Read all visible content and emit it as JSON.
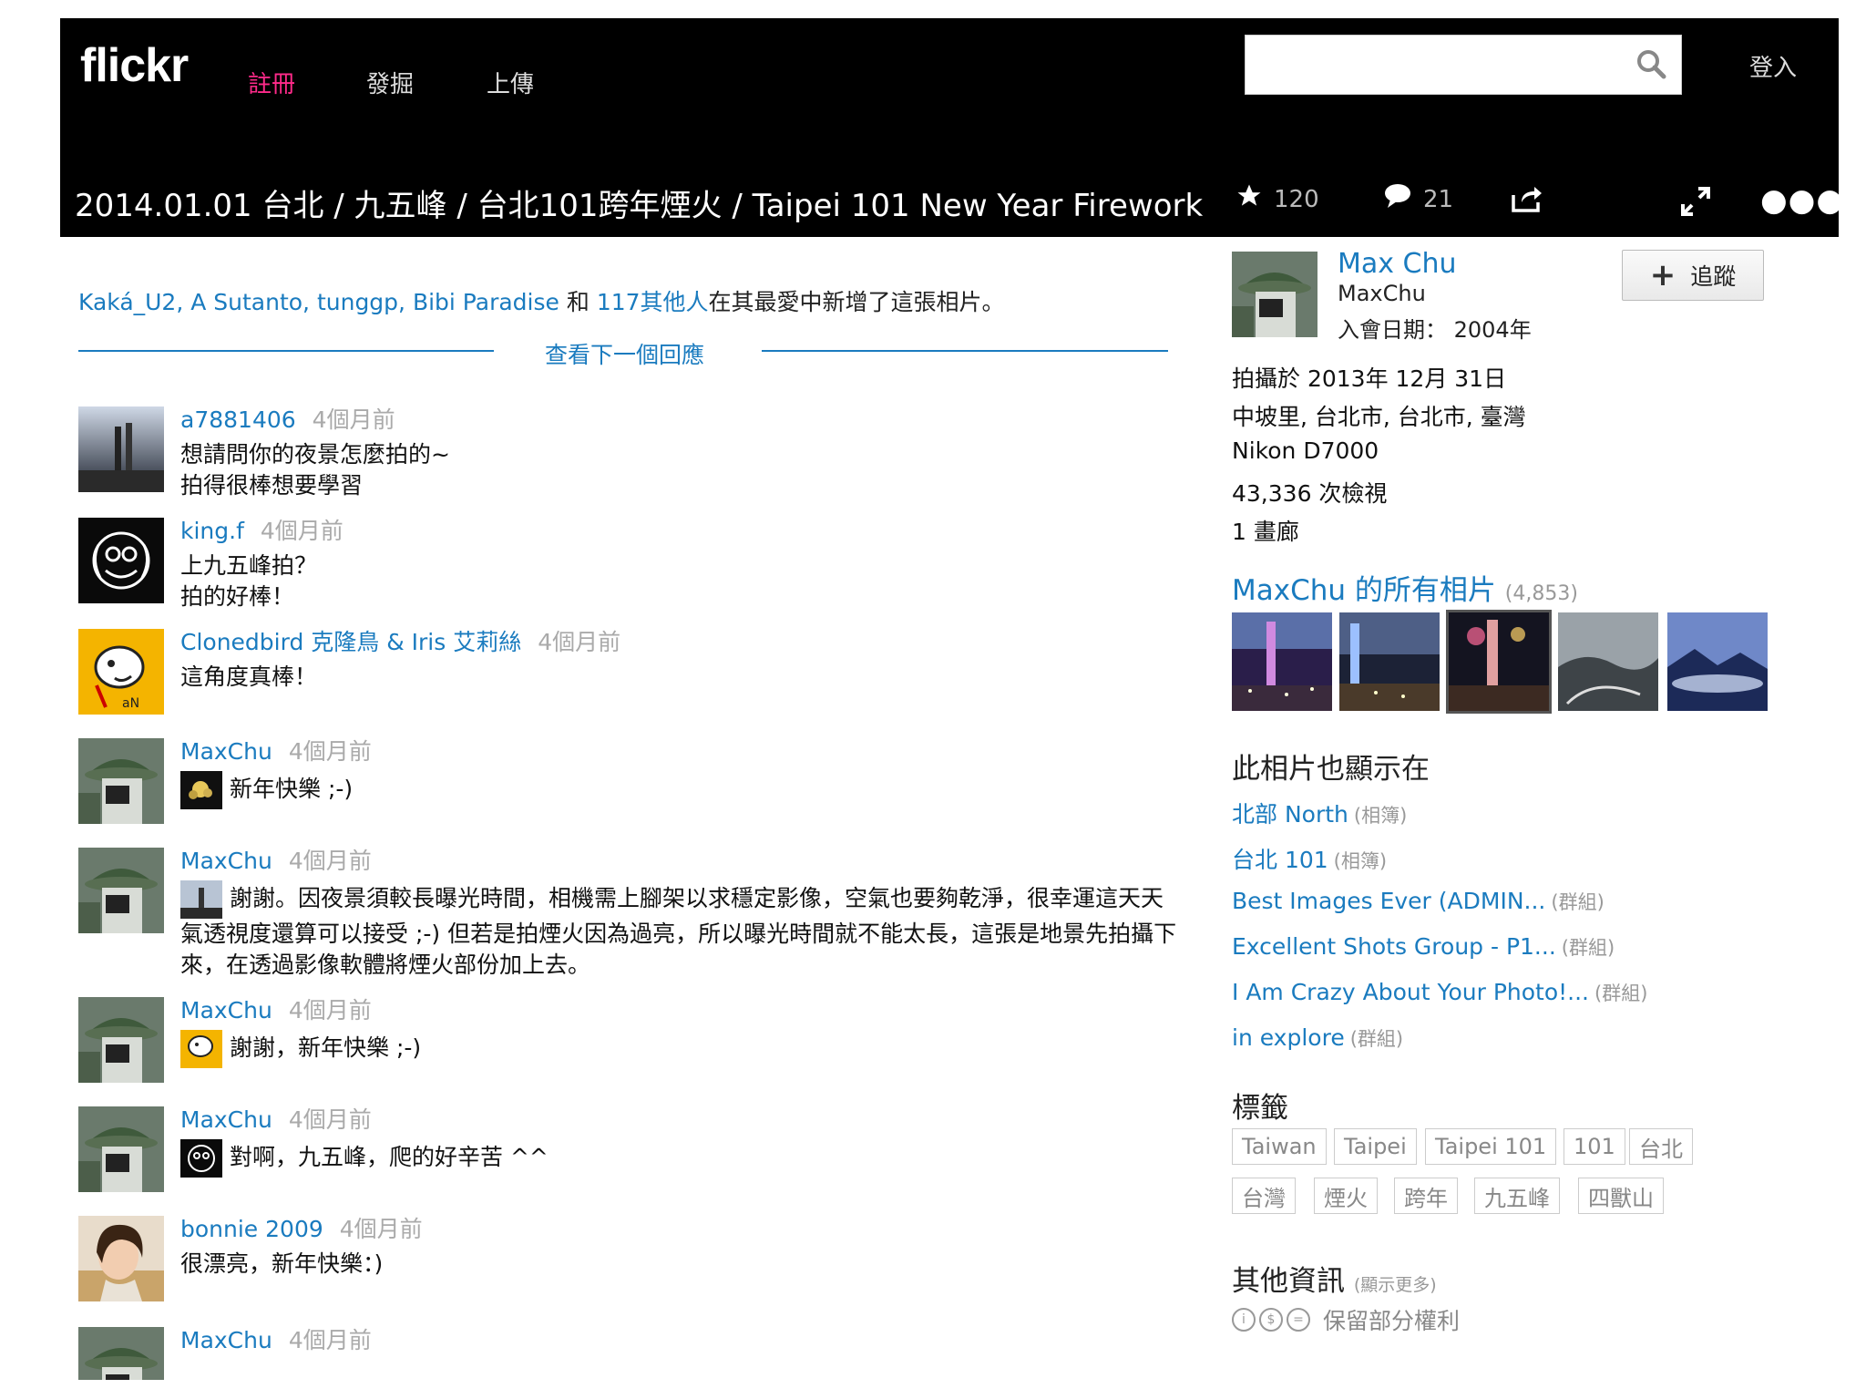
{
  "header": {
    "logo": "flickr",
    "nav": {
      "register": "註冊",
      "explore": "發掘",
      "upload": "上傳"
    },
    "search": {
      "value": "",
      "placeholder": ""
    },
    "login": "登入"
  },
  "photo": {
    "title": "2014.01.01 台北 / 九五峰 / 台北101跨年煙火 / Taipei 101 New Year Firework",
    "faves_count": "120",
    "comments_count": "21"
  },
  "faves_line": {
    "names": "Kaká_U2, A Sutanto, tunggp, Bibi Paradise",
    "and": " 和 ",
    "others": "117其他人",
    "suffix": "在其最愛中新增了這張相片。"
  },
  "next_reply": "查看下一個回應",
  "comments": [
    {
      "author": "a7881406",
      "time": "4個月前",
      "lines": [
        "想請問你的夜景怎麼拍的~",
        "拍得很棒想要學習"
      ]
    },
    {
      "author": "king.f",
      "time": "4個月前",
      "lines": [
        "上九五峰拍？",
        "拍的好棒！"
      ]
    },
    {
      "author": "Clonedbird 克隆鳥 & Iris 艾莉絲",
      "time": "4個月前",
      "lines": [
        "這角度真棒！"
      ]
    },
    {
      "author": "MaxChu",
      "time": "4個月前",
      "text": "新年快樂 ;-)"
    },
    {
      "author": "MaxChu",
      "time": "4個月前",
      "text": "謝謝。因夜景須較長曝光時間，相機需上腳架以求穩定影像，空氣也要夠乾淨，很幸運這天天氣透視度還算可以接受 ;-) 但若是拍煙火因為過亮，所以曝光時間就不能太長，這張是地景先拍攝下來，在透過影像軟體將煙火部份加上去。"
    },
    {
      "author": "MaxChu",
      "time": "4個月前",
      "text": "謝謝，新年快樂 ;-)"
    },
    {
      "author": "MaxChu",
      "time": "4個月前",
      "text": "對啊，九五峰，爬的好辛苦 ^^"
    },
    {
      "author": "bonnie 2009",
      "time": "4個月前",
      "lines": [
        "很漂亮，新年快樂：)"
      ]
    },
    {
      "author": "MaxChu",
      "time": "4個月前"
    }
  ],
  "owner": {
    "name": "Max Chu",
    "username": "MaxChu",
    "joined": "入會日期： 2004年",
    "follow_label": "追蹤"
  },
  "info": {
    "taken": "拍攝於 2013年 12月 31日",
    "location": "中坡里, 台北市, 台北市, 臺灣",
    "camera": "Nikon D7000",
    "views": "43,336 次檢視",
    "galleries": "1 畫廊"
  },
  "photostream": {
    "title": "MaxChu 的所有相片",
    "count": "(4,853)"
  },
  "also_in": {
    "title": "此相片也顯示在",
    "items": [
      {
        "name": "北部 North",
        "kind": "(相簿)"
      },
      {
        "name": "台北 101",
        "kind": "(相簿)"
      },
      {
        "name": "Best Images Ever (ADMIN...",
        "kind": "(群組)"
      },
      {
        "name": "Excellent Shots Group - P1...",
        "kind": "(群組)"
      },
      {
        "name": "I Am Crazy About Your Photo!...",
        "kind": "(群組)"
      },
      {
        "name": "in explore",
        "kind": "(群組)"
      }
    ]
  },
  "tags": {
    "title": "標籤",
    "items": [
      "Taiwan",
      "Taipei",
      "Taipei 101",
      "101",
      "台北",
      "台灣",
      "煙火",
      "跨年",
      "九五峰",
      "四獸山"
    ]
  },
  "more_info": {
    "title": "其他資訊",
    "show_more": "(顯示更多)",
    "license": "保留部分權利"
  },
  "colors": {
    "link": "#1a7bbf",
    "header_bg": "#000000",
    "register_accent": "#ff2a8a"
  }
}
